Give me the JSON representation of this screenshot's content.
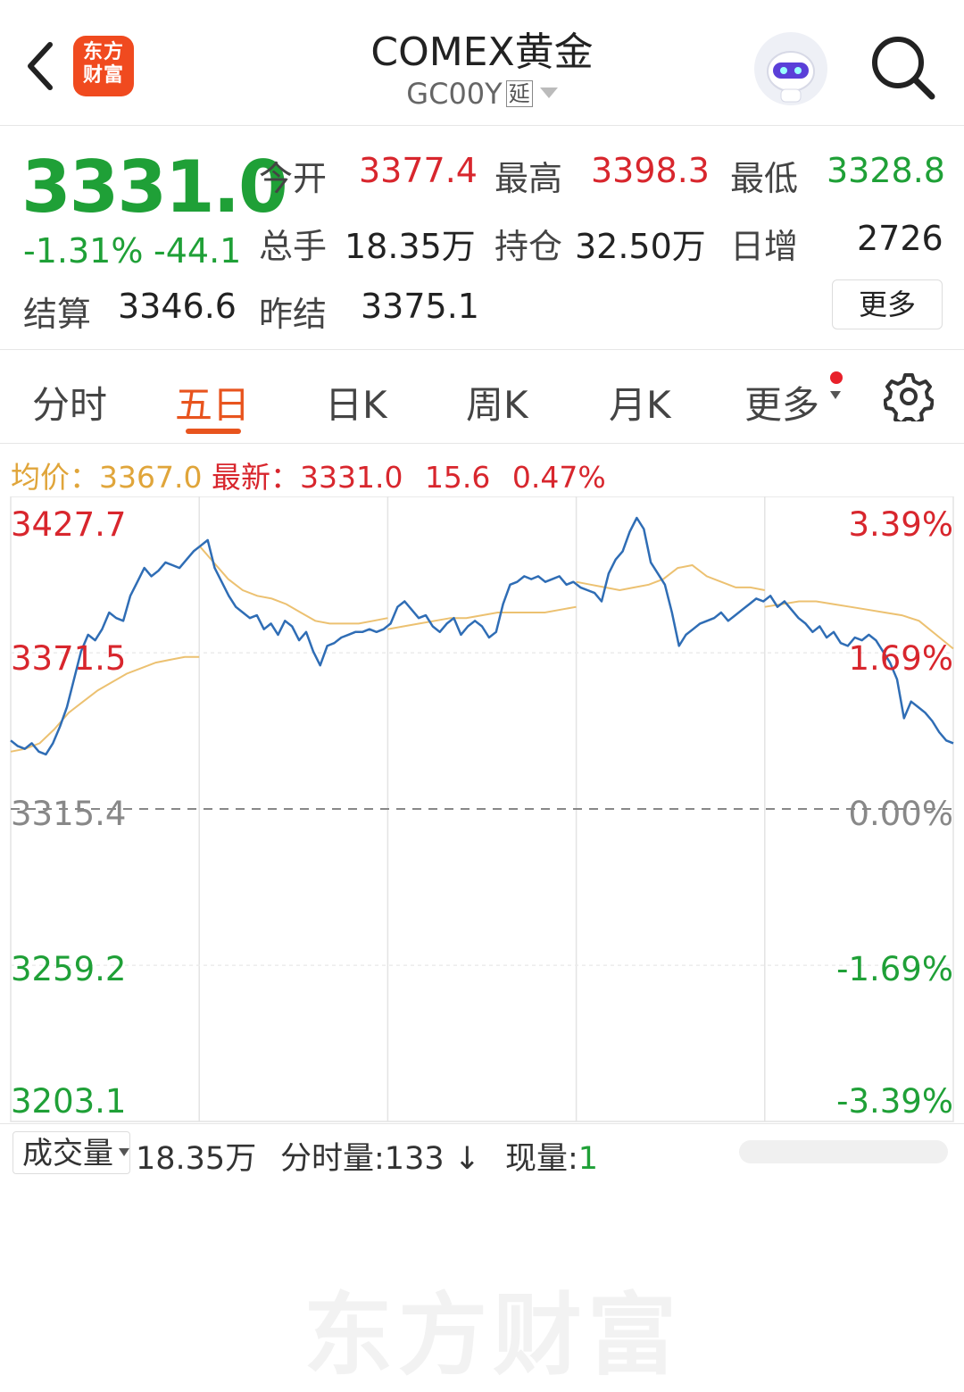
{
  "header": {
    "title": "COMEX黄金",
    "code": "GC00Y",
    "delay_tag": "延",
    "logo_text": "东方财富",
    "icons": [
      "back-arrow-icon",
      "robot-avatar-icon",
      "search-icon"
    ]
  },
  "quote": {
    "price": "3331.0",
    "change_pct": "-1.31%",
    "change": "-44.1",
    "open_label": "今开",
    "open": "3377.4",
    "high_label": "最高",
    "high": "3398.3",
    "low_label": "最低",
    "low": "3328.8",
    "volume_label": "总手",
    "volume": "18.35万",
    "oi_label": "持仓",
    "oi": "32.50万",
    "daily_inc_label": "日增",
    "daily_inc": "2726",
    "settle_label": "结算",
    "settle": "3346.6",
    "prev_settle_label": "昨结",
    "prev_settle": "3375.1",
    "more_button": "更多"
  },
  "tabs": {
    "items": [
      "分时",
      "五日",
      "日K",
      "周K",
      "月K",
      "更多"
    ],
    "active": "五日"
  },
  "legend": {
    "avg_label": "均价：",
    "avg_value": "3367.0",
    "latest_label": "最新：",
    "latest_value": "3331.0",
    "diff": "15.6",
    "diff_pct": "0.47%"
  },
  "chart_data": {
    "type": "line",
    "title": "",
    "y_left_ticks": [
      "3427.7",
      "3371.5",
      "3315.4",
      "3259.2",
      "3203.1"
    ],
    "y_right_ticks": [
      "3.39%",
      "1.69%",
      "0.00%",
      "-1.69%",
      "-3.39%"
    ],
    "ylim": [
      3203.1,
      3427.7
    ],
    "reference_line": 3315.4,
    "days": 5,
    "series": [
      {
        "name": "价格",
        "color": "#2f6db5",
        "values": [
          3340,
          3338,
          3337,
          3339,
          3336,
          3335,
          3339,
          3345,
          3352,
          3362,
          3372,
          3378,
          3376,
          3380,
          3386,
          3384,
          3383,
          3392,
          3397,
          3402,
          3399,
          3401,
          3404,
          3403,
          3402,
          3405,
          3408,
          3410,
          3412,
          3402,
          3397,
          3392,
          3388,
          3386,
          3384,
          3385,
          3380,
          3382,
          3378,
          3383,
          3381,
          3376,
          3379,
          3372,
          3367,
          3374,
          3375,
          3377,
          3378,
          3379,
          3379,
          3380,
          3379,
          3380,
          3382,
          3388,
          3390,
          3387,
          3384,
          3385,
          3381,
          3379,
          3382,
          3384,
          3378,
          3381,
          3383,
          3381,
          3377,
          3379,
          3389,
          3396,
          3397,
          3399,
          3398,
          3399,
          3397,
          3398,
          3399,
          3396,
          3397,
          3395,
          3394,
          3393,
          3390,
          3400,
          3405,
          3408,
          3415,
          3420,
          3416,
          3404,
          3400,
          3396,
          3386,
          3374,
          3378,
          3380,
          3382,
          3383,
          3384,
          3386,
          3383,
          3385,
          3387,
          3389,
          3391,
          3390,
          3392,
          3388,
          3390,
          3387,
          3384,
          3382,
          3379,
          3381,
          3377,
          3379,
          3375,
          3374,
          3377,
          3376,
          3378,
          3376,
          3372,
          3368,
          3362,
          3348,
          3354,
          3352,
          3350,
          3347,
          3343,
          3340,
          3339
        ]
      },
      {
        "name": "均价",
        "color": "#ecc171",
        "values": [
          3336,
          3337,
          3339,
          3344,
          3350,
          3354,
          3358,
          3361,
          3364,
          3366,
          3368,
          3369,
          3370,
          3370,
          3410,
          3404,
          3398,
          3394,
          3392,
          3391,
          3389,
          3386,
          3383,
          3382,
          3382,
          3382,
          3383,
          3384,
          3380,
          3381,
          3382,
          3383,
          3384,
          3384,
          3385,
          3386,
          3386,
          3386,
          3386,
          3387,
          3388,
          3397,
          3396,
          3395,
          3394,
          3395,
          3396,
          3398,
          3402,
          3403,
          3399,
          3397,
          3395,
          3395,
          3394,
          3388,
          3389,
          3390,
          3390,
          3389,
          3388,
          3387,
          3386,
          3385,
          3383,
          3378,
          3373
        ]
      }
    ]
  },
  "footer": {
    "vol_select": "成交量",
    "vol_value": "18.35万",
    "fs_vol_label": "分时量:",
    "fs_vol": "133",
    "fs_arrow": "↓",
    "now_vol_label": "现量:",
    "now_vol": "1"
  },
  "watermark": "东方财富"
}
